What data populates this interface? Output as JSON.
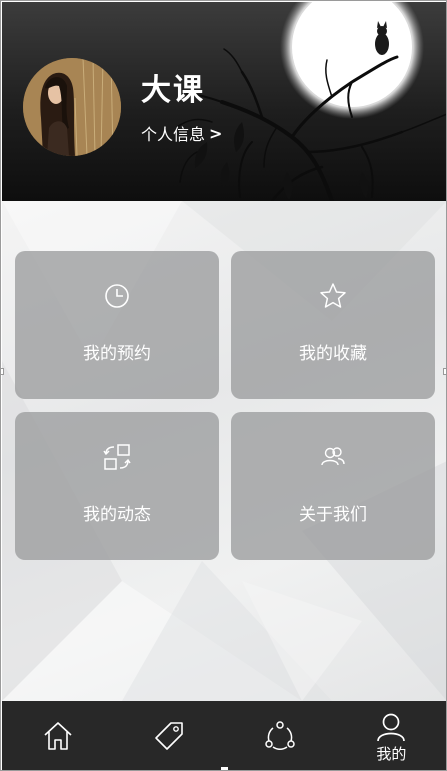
{
  "profile": {
    "name": "大课",
    "link_label": "个人信息",
    "link_arrow": ">"
  },
  "tiles": [
    {
      "label": "我的预约",
      "icon": "clock-icon"
    },
    {
      "label": "我的收藏",
      "icon": "star-icon"
    },
    {
      "label": "我的动态",
      "icon": "swap-icon"
    },
    {
      "label": "关于我们",
      "icon": "users-icon"
    }
  ],
  "tabbar": {
    "items": [
      {
        "icon": "home-icon",
        "label": ""
      },
      {
        "icon": "tag-icon",
        "label": ""
      },
      {
        "icon": "share-icon",
        "label": ""
      },
      {
        "icon": "user-icon",
        "label": "我的"
      }
    ]
  },
  "colors": {
    "header_bg": "#1e1e1e",
    "tile_bg": "#9b9c9e",
    "tabbar_bg": "#282828",
    "text_light": "#ffffff"
  }
}
